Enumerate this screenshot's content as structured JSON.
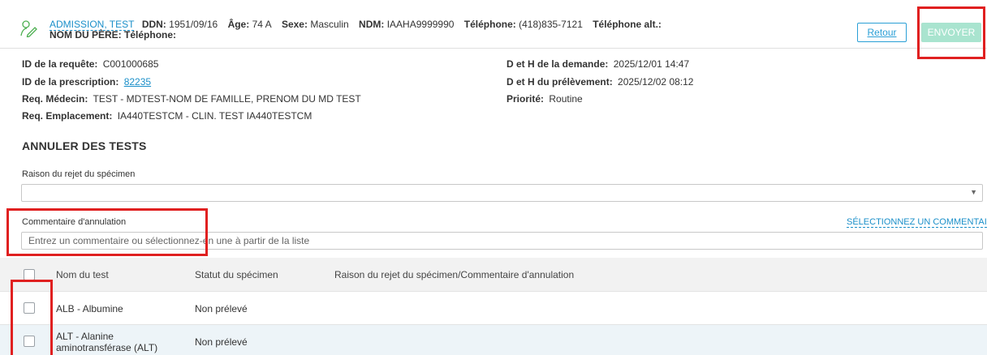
{
  "patient": {
    "name": "ADMISSION, TEST",
    "ddn_label": "DDN:",
    "ddn": "1951/09/16",
    "age_label": "Âge:",
    "age": "74 A",
    "sexe_label": "Sexe:",
    "sexe": "Masculin",
    "ndm_label": "NDM:",
    "ndm": "IAAHA9999990",
    "tel_label": "Téléphone:",
    "tel": "(418)835-7121",
    "tel_alt_label": "Téléphone alt.:",
    "pere_label": "NOM DU PÈRE:",
    "tel2_label": "Téléphone:"
  },
  "buttons": {
    "retour": "Retour",
    "envoyer": "ENVOYER"
  },
  "request": {
    "req_id_label": "ID de la requête:",
    "req_id": "C001000685",
    "presc_label": "ID de la prescription:",
    "presc": "82235",
    "medecin_label": "Req. Médecin:",
    "medecin": "TEST - MDTEST-NOM DE FAMILLE, PRENOM DU MD TEST",
    "emplacement_label": "Req. Emplacement:",
    "emplacement": "IA440TESTCM - CLIN. TEST IA440TESTCM",
    "demande_label": "D et H de la demande:",
    "demande": "2025/12/01 14:47",
    "prelevement_label": "D et H du prélèvement:",
    "prelevement": "2025/12/02 08:12",
    "priorite_label": "Priorité:",
    "priorite": "Routine"
  },
  "section_title": "ANNULER DES TESTS",
  "rejet": {
    "label": "Raison du rejet du spécimen",
    "value": ""
  },
  "commentaire": {
    "label": "Commentaire d'annulation",
    "placeholder": "Entrez un commentaire ou sélectionnez-en une à partir de la liste",
    "select_link": "SÉLECTIONNEZ UN COMMENTAIRE"
  },
  "table": {
    "headers": [
      "Nom du test",
      "Statut du spécimen",
      "Raison du rejet du spécimen/Commentaire d'annulation"
    ],
    "rows": [
      {
        "name": "ALB - Albumine",
        "name2": "",
        "status": "Non prélevé"
      },
      {
        "name": "ALT - Alanine",
        "name2": "aminotransférase (ALT)",
        "status": "Non prélevé"
      }
    ]
  },
  "colors": {
    "accent": "#1a8fc9",
    "envoyer_disabled": "#a9e4cf",
    "highlight": "#e02020",
    "row_alt": "#edf4f8"
  }
}
